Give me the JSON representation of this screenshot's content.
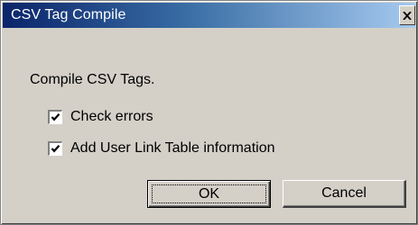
{
  "window": {
    "title": "CSV Tag Compile"
  },
  "dialog": {
    "message": "Compile CSV Tags.",
    "options": [
      {
        "label": "Check errors",
        "checked": true
      },
      {
        "label": "Add User Link Table information",
        "checked": true
      }
    ],
    "ok_label": "OK",
    "cancel_label": "Cancel"
  },
  "icons": {
    "close": "close-icon",
    "check": "check-icon"
  },
  "colors": {
    "title_bar_start": "#0a246a",
    "title_bar_end": "#a6caf0",
    "dialog_face": "#d4d0c8"
  }
}
